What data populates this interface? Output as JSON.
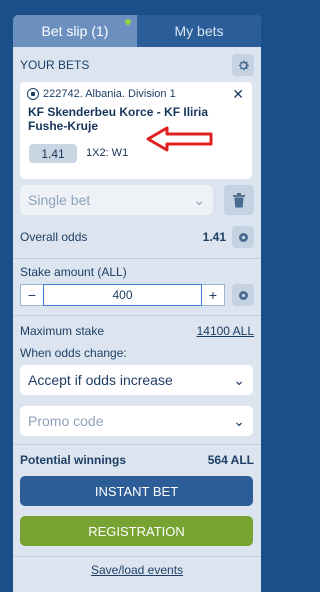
{
  "tabs": [
    {
      "label": "Bet slip (1)",
      "active": true
    },
    {
      "label": "My bets",
      "active": false
    }
  ],
  "your_bets_title": "YOUR BETS",
  "bet": {
    "event": "222742. Albania. Division 1",
    "match": "KF Skenderbeu Korce - KF Iliria Fushe-Kruje",
    "odds": "1.41",
    "pick": "1X2: W1"
  },
  "bet_type": "Single bet",
  "overall_odds_label": "Overall odds",
  "overall_odds_value": "1.41",
  "stake_label": "Stake amount (ALL)",
  "stake_value": "400",
  "stake_minus": "−",
  "stake_plus": "+",
  "max_stake_label": "Maximum stake",
  "max_stake_value": "14100 ALL",
  "odds_change_label": "When odds change:",
  "odds_change_value": "Accept if odds increase",
  "promo_placeholder": "Promo code",
  "potential_label": "Potential winnings",
  "potential_value": "564 ALL",
  "instant_bet_label": "INSTANT BET",
  "registration_label": "REGISTRATION",
  "save_load_label": "Save/load events",
  "colors": {
    "accent_blue": "#2d5d97",
    "registration_green": "#76a331",
    "notification_dot": "#8ed24a",
    "annotation_arrow": "#e02020"
  }
}
